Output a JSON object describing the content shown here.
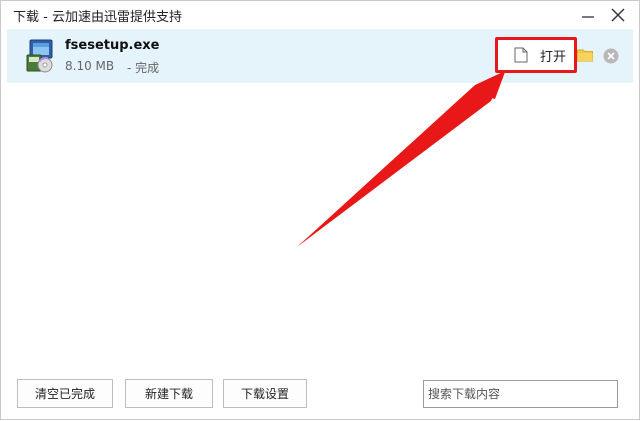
{
  "window": {
    "title": "下载 - 云加速由迅雷提供支持"
  },
  "downloads": [
    {
      "name": "fsesetup.exe",
      "size": "8.10 MB",
      "status": "- 完成",
      "open_label": "打开",
      "icon": "installer-icon"
    }
  ],
  "footer": {
    "clear_label": "清空已完成",
    "new_label": "新建下载",
    "settings_label": "下载设置",
    "search_placeholder": "搜索下载内容"
  },
  "colors": {
    "selected_row": "#e5f3fb",
    "highlight_red": "#e81818",
    "folder": "#f4c74a"
  }
}
